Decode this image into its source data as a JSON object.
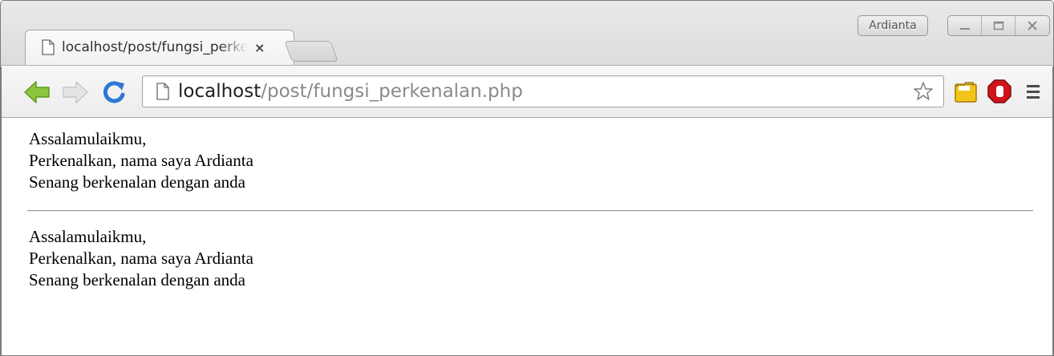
{
  "window": {
    "profile_name": "Ardianta"
  },
  "tab": {
    "title": "localhost/post/fungsi_perkenalan.php",
    "close_glyph": "×"
  },
  "omnibox": {
    "url_host": "localhost",
    "url_path": "/post/fungsi_perkenalan.php"
  },
  "page": {
    "sections": [
      {
        "lines": [
          "Assalamulaikmu,",
          "Perkenalkan, nama saya Ardianta",
          "Senang berkenalan dengan anda"
        ]
      },
      {
        "lines": [
          "Assalamulaikmu,",
          "Perkenalkan, nama saya Ardianta",
          "Senang berkenalan dengan anda"
        ]
      }
    ]
  },
  "icons": {
    "back": "back-arrow-icon",
    "forward": "forward-arrow-icon",
    "reload": "reload-icon",
    "page": "page-icon",
    "bookmark": "star-icon",
    "extension1": "folder-extension-icon",
    "extension2": "stop-extension-icon",
    "menu": "menu-icon"
  },
  "colors": {
    "back_arrow": "#7fbf2a",
    "reload": "#2d78d2",
    "stop_ext": "#d0141a",
    "folder_ext": "#f2c417"
  }
}
